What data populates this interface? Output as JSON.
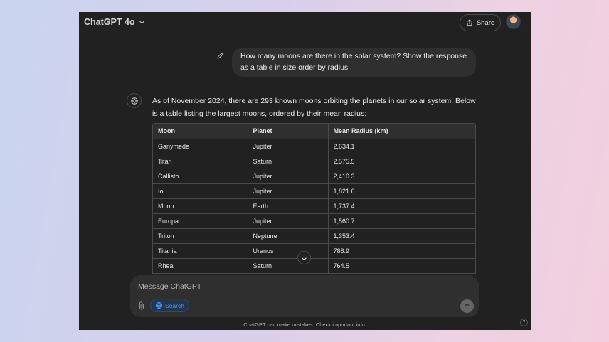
{
  "header": {
    "model_label": "ChatGPT 4o",
    "share_label": "Share"
  },
  "conversation": {
    "user_message": "How many moons are there in the solar system? Show the response as a table in size order by radius",
    "assistant_intro": "As of November 2024, there are 293 known moons orbiting the planets in our solar system. Below is a table listing the largest moons, ordered by their mean radius:",
    "table": {
      "columns": [
        "Moon",
        "Planet",
        "Mean Radius (km)"
      ],
      "rows": [
        [
          "Ganymede",
          "Jupiter",
          "2,634.1"
        ],
        [
          "Titan",
          "Saturn",
          "2,575.5"
        ],
        [
          "Callisto",
          "Jupiter",
          "2,410.3"
        ],
        [
          "Io",
          "Jupiter",
          "1,821.6"
        ],
        [
          "Moon",
          "Earth",
          "1,737.4"
        ],
        [
          "Europa",
          "Jupiter",
          "1,560.7"
        ],
        [
          "Triton",
          "Neptune",
          "1,353.4"
        ],
        [
          "Titania",
          "Uranus",
          "788.9"
        ],
        [
          "Rhea",
          "Saturn",
          "764.5"
        ]
      ]
    }
  },
  "composer": {
    "placeholder": "Message ChatGPT",
    "search_label": "Search"
  },
  "footer": {
    "disclaimer": "ChatGPT can make mistakes. Check important info.",
    "help_label": "?"
  },
  "colors": {
    "background": "#212121",
    "bubble": "#2f2f2f",
    "accent_blue": "#4d9aff"
  }
}
